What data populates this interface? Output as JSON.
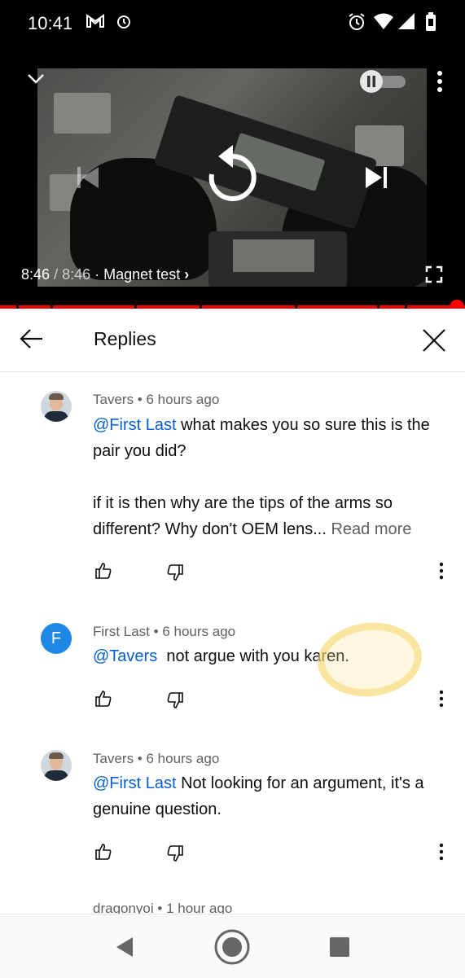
{
  "status_bar": {
    "time": "10:41",
    "icons": [
      "gmail-icon",
      "notification-icon",
      "alarm-icon",
      "wifi-icon",
      "signal-icon",
      "battery-icon"
    ]
  },
  "player": {
    "current_time": "8:46",
    "duration": "/ 8:46",
    "separator": "·",
    "chapter": "Magnet test",
    "chapter_chevron": "›",
    "progress_fraction": 1.0,
    "icons": [
      "collapse-chevron-icon",
      "autoplay-pause-toggle-icon",
      "more-vert-icon",
      "previous-icon",
      "replay-icon",
      "next-icon",
      "fullscreen-icon"
    ]
  },
  "replies_panel": {
    "title": "Replies",
    "icons": [
      "back-arrow-icon",
      "close-icon"
    ]
  },
  "comments": [
    {
      "author": "Tavers",
      "age": "6 hours ago",
      "mention": "@First Last",
      "text_line1": " what makes you so sure this is the pair you did?",
      "text_para2": "if it is then why are the tips of the arms so different? Why don't OEM lens...",
      "read_more": "Read more",
      "avatar": "photo"
    },
    {
      "author": "First Last",
      "age": "6 hours ago",
      "mention": "@Tavers",
      "text_line1": "  not argue with you karen.",
      "avatar_letter": "F"
    },
    {
      "author": "Tavers",
      "age": "6 hours ago",
      "mention": "@First Last",
      "text_line1": " Not looking for an argument, it's a genuine question.",
      "avatar": "photo"
    },
    {
      "author": "dragonyoi",
      "age": "1 hour ago",
      "partial": true
    }
  ],
  "comment_actions": [
    "thumbs-up-icon",
    "thumbs-down-icon",
    "more-vert-icon"
  ],
  "nav_bar": {
    "icons": [
      "nav-back-icon",
      "nav-home-icon",
      "nav-recents-icon"
    ]
  },
  "colors": {
    "accent_red": "#ff0000",
    "mention_blue": "#065fd4",
    "avatar_blue": "#1e88e5",
    "highlight_yellow": "#f5d76e"
  }
}
